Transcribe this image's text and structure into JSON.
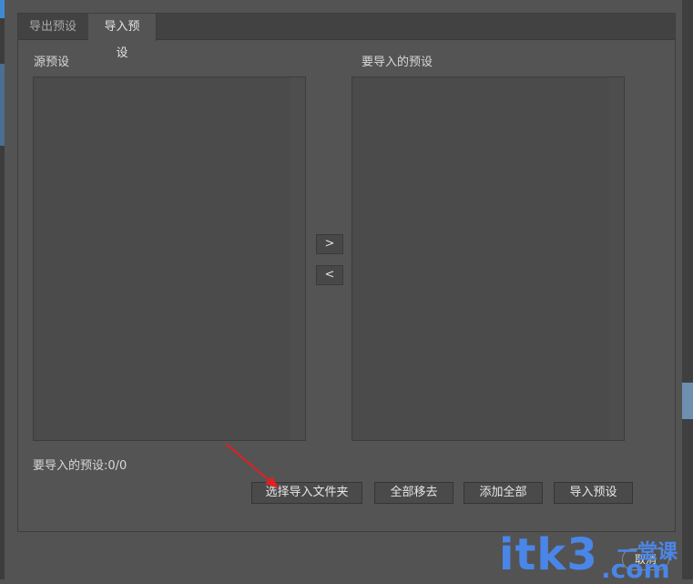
{
  "tabs": [
    {
      "label": "导出预设",
      "active": false
    },
    {
      "label": "导入预设",
      "active": true
    }
  ],
  "source_panel": {
    "label": "源预设",
    "items": []
  },
  "target_panel": {
    "label": "要导入的预设",
    "items": []
  },
  "move_buttons": {
    "add": ">",
    "remove": "<"
  },
  "count": {
    "text": "要导入的预设:0/0"
  },
  "buttons": {
    "select_folder": "选择导入文件夹",
    "remove_all": "全部移去",
    "add_all": "添加全部",
    "import": "导入预设"
  },
  "footer_button": "取消",
  "watermark": {
    "main": "itk3",
    "sub": "一堂课",
    "tail": ".com"
  },
  "colors": {
    "background": "#535353",
    "panel": "#4b4b4b",
    "annotation_arrow": "#e02020",
    "watermark": "#4a86e8"
  }
}
